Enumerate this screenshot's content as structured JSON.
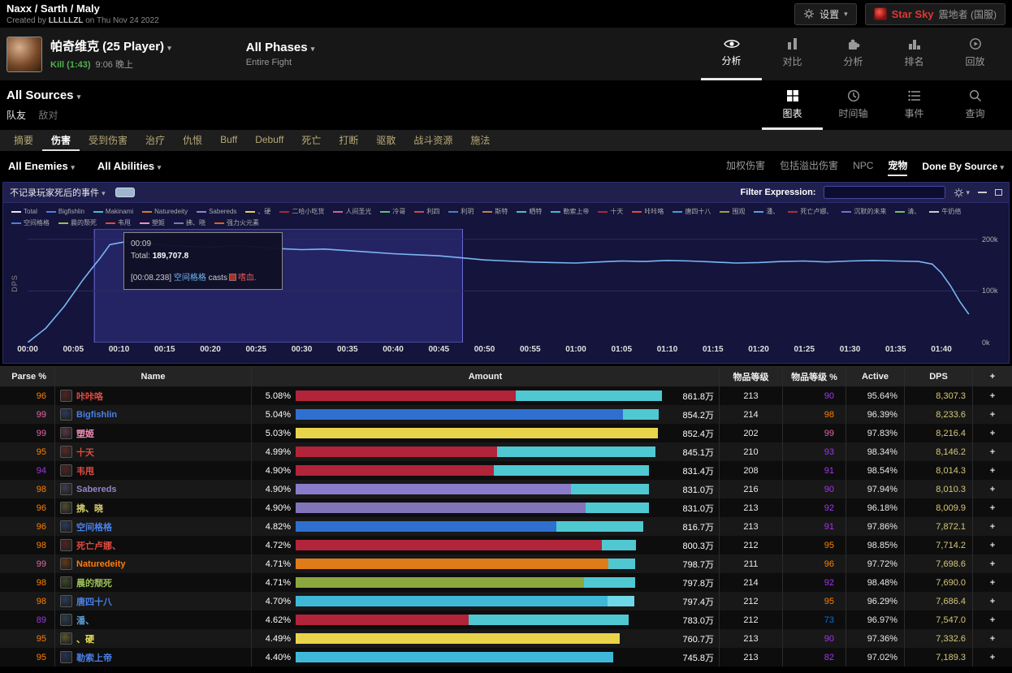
{
  "topbar": {
    "title": "Naxx / Sarth / Maly",
    "created_prefix": "Created by ",
    "author": "LLLLLZL",
    "created_suffix": " on Thu Nov 24 2022",
    "settings_label": "设置",
    "guild": {
      "name": "Star Sky",
      "server": "震地者 (国服)"
    }
  },
  "fightbar": {
    "boss_name": "帕奇维克 (25 Player)",
    "kill_label": "Kill (1:43)",
    "kill_time": "9:06 晚上",
    "phases_label": "All Phases",
    "phases_sub": "Entire Fight",
    "nav": [
      {
        "label": "分析",
        "icon": "eye-icon",
        "active": true
      },
      {
        "label": "对比",
        "icon": "compare-icon",
        "active": false
      },
      {
        "label": "分析",
        "icon": "puzzle-icon",
        "active": false
      },
      {
        "label": "排名",
        "icon": "ranking-icon",
        "active": false
      },
      {
        "label": "回放",
        "icon": "replay-icon",
        "active": false
      }
    ]
  },
  "sourcebar": {
    "sources_label": "All Sources",
    "friendlies": "队友",
    "enemies": "敌对",
    "views": [
      {
        "label": "图表",
        "icon": "grid-icon",
        "active": true
      },
      {
        "label": "时间轴",
        "icon": "clock-icon",
        "active": false
      },
      {
        "label": "事件",
        "icon": "events-icon",
        "active": false
      },
      {
        "label": "查询",
        "icon": "search-icon",
        "active": false
      }
    ]
  },
  "tabs": {
    "items": [
      "摘要",
      "伤害",
      "受到伤害",
      "治疗",
      "仇恨",
      "Buff",
      "Debuff",
      "死亡",
      "打断",
      "驱散",
      "战斗资源",
      "施法"
    ],
    "active": "伤害"
  },
  "filterbar": {
    "enemies_dropdown": "All Enemies",
    "abilities_dropdown": "All Abilities",
    "options": [
      "加权伤害",
      "包括溢出伤害",
      "NPC",
      "宠物"
    ],
    "active_option": "宠物",
    "done_by": "Done By Source"
  },
  "chart": {
    "header_label": "不记录玩家死后的事件",
    "filter_label": "Filter Expression:",
    "ylabel": "DPS",
    "tooltip": {
      "time": "00:09",
      "total_label": "Total:",
      "total_value": "189,707.8",
      "event_time": "[00:08.238]",
      "caster": "空间格格",
      "verb": "casts",
      "spell": "嗜血."
    },
    "legend": [
      {
        "label": "Total",
        "color": "#e8e8e8"
      },
      {
        "label": "Bigfishlin",
        "color": "#4a80e8"
      },
      {
        "label": "Makinami",
        "color": "#3fc0d0"
      },
      {
        "label": "Naturedeity",
        "color": "#e07b1a"
      },
      {
        "label": "Sabereds",
        "color": "#9482c9"
      },
      {
        "label": "、硬",
        "color": "#e8d44a"
      },
      {
        "label": "二哈小吃货",
        "color": "#b1243a"
      },
      {
        "label": "人间圣光",
        "color": "#d060a0"
      },
      {
        "label": "冷哥",
        "color": "#60c080"
      },
      {
        "label": "利四",
        "color": "#c05050"
      },
      {
        "label": "利玥",
        "color": "#5080c0"
      },
      {
        "label": "斯特",
        "color": "#c08050"
      },
      {
        "label": "晒特",
        "color": "#50c0c0"
      },
      {
        "label": "勒索上帝",
        "color": "#3fb8d8"
      },
      {
        "label": "十天",
        "color": "#b1243a"
      },
      {
        "label": "咔咔咯",
        "color": "#e04a3f"
      },
      {
        "label": "唐四十八",
        "color": "#40a0d0"
      },
      {
        "label": "围观",
        "color": "#a0a040"
      },
      {
        "label": "潘、",
        "color": "#5aa0d8"
      },
      {
        "label": "死亡卢娜、",
        "color": "#b03030"
      },
      {
        "label": "沉默的未来",
        "color": "#7070d0"
      },
      {
        "label": "清、",
        "color": "#70c070"
      },
      {
        "label": "牛奶络",
        "color": "#cccccc"
      },
      {
        "label": "空间格格",
        "color": "#4a80e8"
      },
      {
        "label": "晨的颓死",
        "color": "#9cbf58"
      },
      {
        "label": "韦甩",
        "color": "#e04a3f"
      },
      {
        "label": "塑姬",
        "color": "#f48cba"
      },
      {
        "label": "拂、晓",
        "color": "#8274b8"
      },
      {
        "label": "强力火元素",
        "color": "#e06020"
      }
    ]
  },
  "chart_data": {
    "type": "line",
    "ylabel": "DPS",
    "ylim": [
      0,
      220000
    ],
    "tmax": 104,
    "line_color": "#79b6f2",
    "selection": {
      "t0": 7.3,
      "t1": 47.6
    },
    "y_ticks": [
      {
        "v": 0,
        "label": "0k"
      },
      {
        "v": 100000,
        "label": "100k"
      },
      {
        "v": 200000,
        "label": "200k"
      }
    ],
    "x_ticks": [
      {
        "t": 0,
        "label": "00:00"
      },
      {
        "t": 5,
        "label": "00:05"
      },
      {
        "t": 10,
        "label": "00:10"
      },
      {
        "t": 15,
        "label": "00:15"
      },
      {
        "t": 20,
        "label": "00:20"
      },
      {
        "t": 25,
        "label": "00:25"
      },
      {
        "t": 30,
        "label": "00:30"
      },
      {
        "t": 35,
        "label": "00:35"
      },
      {
        "t": 40,
        "label": "00:40"
      },
      {
        "t": 45,
        "label": "00:45"
      },
      {
        "t": 50,
        "label": "00:50"
      },
      {
        "t": 55,
        "label": "00:55"
      },
      {
        "t": 60,
        "label": "01:00"
      },
      {
        "t": 65,
        "label": "01:05"
      },
      {
        "t": 70,
        "label": "01:10"
      },
      {
        "t": 75,
        "label": "01:15"
      },
      {
        "t": 80,
        "label": "01:20"
      },
      {
        "t": 85,
        "label": "01:25"
      },
      {
        "t": 90,
        "label": "01:30"
      },
      {
        "t": 95,
        "label": "01:35"
      },
      {
        "t": 100,
        "label": "01:40"
      }
    ],
    "series": [
      {
        "name": "Total",
        "points": [
          [
            0,
            0
          ],
          [
            2,
            28000
          ],
          [
            4,
            70000
          ],
          [
            5,
            95000
          ],
          [
            6,
            120000
          ],
          [
            7,
            143000
          ],
          [
            8,
            165000
          ],
          [
            9,
            189708
          ],
          [
            10,
            193000
          ],
          [
            11,
            196000
          ],
          [
            12.5,
            195000
          ],
          [
            14,
            190000
          ],
          [
            15,
            188000
          ],
          [
            17.5,
            186000
          ],
          [
            20,
            185000
          ],
          [
            22.5,
            187000
          ],
          [
            25,
            185500
          ],
          [
            27.5,
            182000
          ],
          [
            30,
            180000
          ],
          [
            32.5,
            181000
          ],
          [
            35,
            178000
          ],
          [
            37.5,
            175000
          ],
          [
            40,
            172000
          ],
          [
            42.5,
            170000
          ],
          [
            45,
            168000
          ],
          [
            47.5,
            164000
          ],
          [
            50,
            160000
          ],
          [
            52.5,
            158000
          ],
          [
            55,
            156000
          ],
          [
            57.5,
            155000
          ],
          [
            60,
            154000
          ],
          [
            62.5,
            156000
          ],
          [
            65,
            158000
          ],
          [
            67.5,
            157000
          ],
          [
            70,
            159000
          ],
          [
            72.5,
            158000
          ],
          [
            75,
            156000
          ],
          [
            77.5,
            154000
          ],
          [
            80,
            155000
          ],
          [
            82.5,
            157000
          ],
          [
            85,
            158000
          ],
          [
            87.5,
            156000
          ],
          [
            90,
            158000
          ],
          [
            92.5,
            159000
          ],
          [
            95,
            158000
          ],
          [
            97.5,
            157000
          ],
          [
            99,
            152000
          ],
          [
            100,
            135000
          ],
          [
            101,
            110000
          ],
          [
            102,
            80000
          ],
          [
            103,
            55000
          ]
        ]
      }
    ]
  },
  "table": {
    "headers": [
      "Parse %",
      "Name",
      "Amount",
      "物品等级",
      "物品等级 %",
      "Active",
      "DPS",
      "+"
    ],
    "plus_label": "+",
    "rows": [
      {
        "parse": "96",
        "parse_color": "#ff8000",
        "name": "咔咔咯",
        "name_color": "#e04a3f",
        "pct": "5.08%",
        "frac": 1.0,
        "segs": [
          {
            "color": "#b1243a",
            "f": 0.6
          },
          {
            "color": "#4fc8d2",
            "f": 0.4
          }
        ],
        "amount": "861.8万",
        "ilvl": "213",
        "ilvl_pct": "90",
        "ilvl_pct_color": "#a335ee",
        "active": "95.64%",
        "dps": "8,307.3"
      },
      {
        "parse": "99",
        "parse_color": "#e268a8",
        "name": "Bigfishlin",
        "name_color": "#4a80e8",
        "pct": "5.04%",
        "frac": 0.992,
        "segs": [
          {
            "color": "#2f6fd0",
            "f": 0.9
          },
          {
            "color": "#4fc8d2",
            "f": 0.1
          }
        ],
        "amount": "854.2万",
        "ilvl": "214",
        "ilvl_pct": "98",
        "ilvl_pct_color": "#ff8000",
        "active": "96.39%",
        "dps": "8,233.6"
      },
      {
        "parse": "99",
        "parse_color": "#e268a8",
        "name": "塑姬",
        "name_color": "#f48cba",
        "pct": "5.03%",
        "frac": 0.99,
        "segs": [
          {
            "color": "#e8d44a",
            "f": 1.0
          }
        ],
        "amount": "852.4万",
        "ilvl": "202",
        "ilvl_pct": "99",
        "ilvl_pct_color": "#e268a8",
        "active": "97.83%",
        "dps": "8,216.4"
      },
      {
        "parse": "95",
        "parse_color": "#ff8000",
        "name": "十天",
        "name_color": "#e04a3f",
        "pct": "4.99%",
        "frac": 0.982,
        "segs": [
          {
            "color": "#b1243a",
            "f": 0.56
          },
          {
            "color": "#4fc8d2",
            "f": 0.44
          }
        ],
        "amount": "845.1万",
        "ilvl": "210",
        "ilvl_pct": "93",
        "ilvl_pct_color": "#a335ee",
        "active": "98.34%",
        "dps": "8,146.2"
      },
      {
        "parse": "94",
        "parse_color": "#a335ee",
        "name": "韦甩",
        "name_color": "#e04a3f",
        "pct": "4.90%",
        "frac": 0.965,
        "segs": [
          {
            "color": "#b1243a",
            "f": 0.56
          },
          {
            "color": "#4fc8d2",
            "f": 0.44
          }
        ],
        "amount": "831.4万",
        "ilvl": "208",
        "ilvl_pct": "91",
        "ilvl_pct_color": "#a335ee",
        "active": "98.54%",
        "dps": "8,014.3"
      },
      {
        "parse": "98",
        "parse_color": "#ff8000",
        "name": "Sabereds",
        "name_color": "#9482c9",
        "pct": "4.90%",
        "frac": 0.965,
        "segs": [
          {
            "color": "#8a7cc9",
            "f": 0.78
          },
          {
            "color": "#4fc8d2",
            "f": 0.22
          }
        ],
        "amount": "831.0万",
        "ilvl": "216",
        "ilvl_pct": "90",
        "ilvl_pct_color": "#a335ee",
        "active": "97.94%",
        "dps": "8,010.3"
      },
      {
        "parse": "96",
        "parse_color": "#ff8000",
        "name": "拂、晓",
        "name_color": "#d8cf6a",
        "pct": "4.90%",
        "frac": 0.965,
        "segs": [
          {
            "color": "#8274b8",
            "f": 0.82
          },
          {
            "color": "#4fc8d2",
            "f": 0.18
          }
        ],
        "amount": "831.0万",
        "ilvl": "213",
        "ilvl_pct": "92",
        "ilvl_pct_color": "#a335ee",
        "active": "96.18%",
        "dps": "8,009.9"
      },
      {
        "parse": "96",
        "parse_color": "#ff8000",
        "name": "空间格格",
        "name_color": "#4a80e8",
        "pct": "4.82%",
        "frac": 0.949,
        "segs": [
          {
            "color": "#2f6fd0",
            "f": 0.75
          },
          {
            "color": "#4fc8d2",
            "f": 0.25
          }
        ],
        "amount": "816.7万",
        "ilvl": "213",
        "ilvl_pct": "91",
        "ilvl_pct_color": "#a335ee",
        "active": "97.86%",
        "dps": "7,872.1"
      },
      {
        "parse": "98",
        "parse_color": "#ff8000",
        "name": "死亡卢娜、",
        "name_color": "#e04a3f",
        "pct": "4.72%",
        "frac": 0.929,
        "segs": [
          {
            "color": "#b1243a",
            "f": 0.9
          },
          {
            "color": "#4fc8d2",
            "f": 0.1
          }
        ],
        "amount": "800.3万",
        "ilvl": "212",
        "ilvl_pct": "95",
        "ilvl_pct_color": "#ff8000",
        "active": "98.85%",
        "dps": "7,714.2"
      },
      {
        "parse": "99",
        "parse_color": "#e268a8",
        "name": "Naturedeity",
        "name_color": "#ff7c0a",
        "pct": "4.71%",
        "frac": 0.927,
        "segs": [
          {
            "color": "#e07b1a",
            "f": 0.92
          },
          {
            "color": "#4fc8d2",
            "f": 0.08
          }
        ],
        "amount": "798.7万",
        "ilvl": "211",
        "ilvl_pct": "96",
        "ilvl_pct_color": "#ff8000",
        "active": "97.72%",
        "dps": "7,698.6"
      },
      {
        "parse": "98",
        "parse_color": "#ff8000",
        "name": "晨的颓死",
        "name_color": "#9cbf58",
        "pct": "4.71%",
        "frac": 0.927,
        "segs": [
          {
            "color": "#8aa83d",
            "f": 0.85
          },
          {
            "color": "#4fc8d2",
            "f": 0.15
          }
        ],
        "amount": "797.8万",
        "ilvl": "214",
        "ilvl_pct": "92",
        "ilvl_pct_color": "#a335ee",
        "active": "98.48%",
        "dps": "7,690.0"
      },
      {
        "parse": "98",
        "parse_color": "#ff8000",
        "name": "唐四十八",
        "name_color": "#4a80e8",
        "pct": "4.70%",
        "frac": 0.925,
        "segs": [
          {
            "color": "#3fb8d8",
            "f": 0.92
          },
          {
            "color": "#6fd8e8",
            "f": 0.08
          }
        ],
        "amount": "797.4万",
        "ilvl": "212",
        "ilvl_pct": "95",
        "ilvl_pct_color": "#ff8000",
        "active": "96.29%",
        "dps": "7,686.4"
      },
      {
        "parse": "89",
        "parse_color": "#a335ee",
        "name": "潘、",
        "name_color": "#5aa0d8",
        "pct": "4.62%",
        "frac": 0.909,
        "segs": [
          {
            "color": "#b1243a",
            "f": 0.52
          },
          {
            "color": "#4fc8d2",
            "f": 0.48
          }
        ],
        "amount": "783.0万",
        "ilvl": "212",
        "ilvl_pct": "73",
        "ilvl_pct_color": "#0070dd",
        "active": "96.97%",
        "dps": "7,547.0"
      },
      {
        "parse": "95",
        "parse_color": "#ff8000",
        "name": "、硬",
        "name_color": "#e8dc5a",
        "pct": "4.49%",
        "frac": 0.884,
        "segs": [
          {
            "color": "#e8d44a",
            "f": 1.0
          }
        ],
        "amount": "760.7万",
        "ilvl": "213",
        "ilvl_pct": "90",
        "ilvl_pct_color": "#a335ee",
        "active": "97.36%",
        "dps": "7,332.6"
      },
      {
        "parse": "95",
        "parse_color": "#ff8000",
        "name": "勒索上帝",
        "name_color": "#4a80e8",
        "pct": "4.40%",
        "frac": 0.866,
        "segs": [
          {
            "color": "#3fb8d8",
            "f": 1.0
          }
        ],
        "amount": "745.8万",
        "ilvl": "213",
        "ilvl_pct": "82",
        "ilvl_pct_color": "#a335ee",
        "active": "97.02%",
        "dps": "7,189.3"
      }
    ]
  }
}
